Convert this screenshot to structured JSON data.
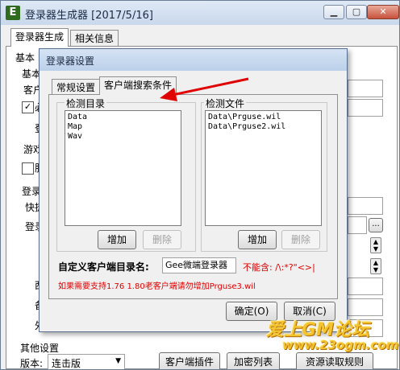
{
  "window": {
    "app_icon_letter": "E",
    "title": "登录器生成器 [2017/5/16]"
  },
  "main_tabs": [
    "登录器生成",
    "相关信息"
  ],
  "background": {
    "partial_labels": [
      "基本",
      "基本",
      "客户",
      "必",
      "登",
      "游戏",
      "服",
      "登录",
      "快捷",
      "登录",
      "西",
      "备",
      "外"
    ],
    "check_mark": "✓",
    "ellipsis": "...",
    "other_settings_label": "其他设置",
    "version_label": "版本:",
    "version_value": "连击版",
    "client_plugin_button": "客户端插件",
    "encrypt_list_button": "加密列表",
    "resource_button": "资源读取规则"
  },
  "dialog": {
    "title": "登录器设置",
    "tabs": [
      "常规设置",
      "客户端搜索条件"
    ],
    "dir_group": {
      "title": "检测目录",
      "items": [
        "Data",
        "Map",
        "Wav"
      ],
      "add_button": "增加",
      "delete_button": "删除"
    },
    "file_group": {
      "title": "检测文件",
      "items": [
        "Data\\Prguse.wil",
        "Data\\Prguse2.wil"
      ],
      "add_button": "增加",
      "delete_button": "删除"
    },
    "custom_dir_label": "自定义客户端目录名:",
    "custom_dir_value": "Gee微端登录器",
    "forbidden_chars": "不能含: /\\:*?\"<>|",
    "note": "如果需要支持1.76 1.80老客户端请勿增加Prguse3.wil",
    "ok_button": "确定(O)",
    "cancel_button": "取消(C)"
  },
  "watermark": {
    "line1": "爱上GM论坛",
    "line2": "www.23ogm.com"
  },
  "colors": {
    "note_red": "#e00000",
    "arrow_red": "#e00000",
    "watermark_yellow": "#f4c430"
  }
}
